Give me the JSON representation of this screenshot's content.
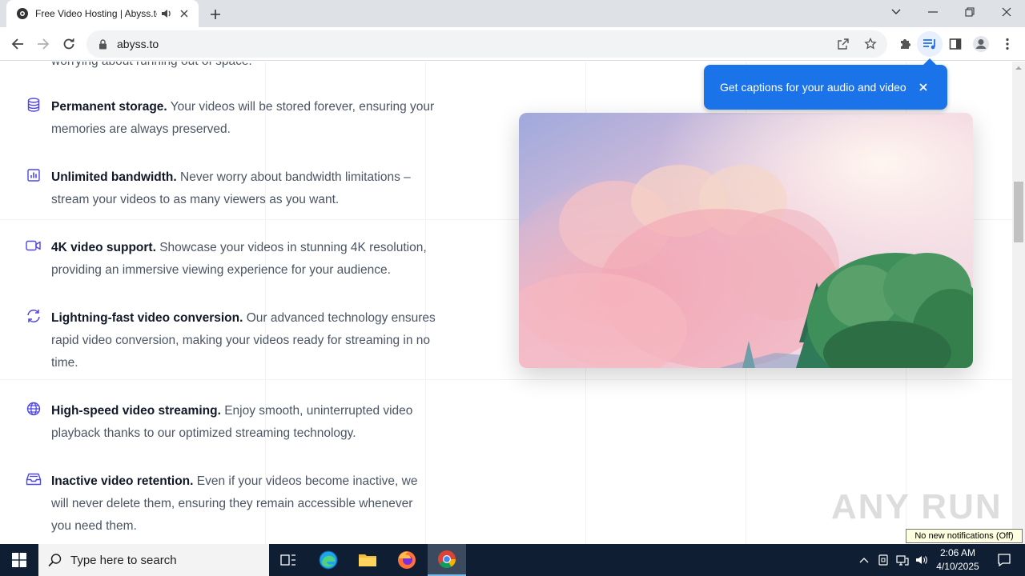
{
  "browser": {
    "tab_title": "Free Video Hosting | Abyss.to",
    "url": "abyss.to",
    "tab_favicon_icon": "abyss-favicon-icon",
    "caption_bubble_text": "Get captions for your audio and video"
  },
  "page": {
    "partial_text": "worrying about running out of space.",
    "features": [
      {
        "icon": "database-icon",
        "title": "Permanent storage.",
        "desc": " Your videos will be stored forever, ensuring your memories are always preserved."
      },
      {
        "icon": "bar-chart-icon",
        "title": "Unlimited bandwidth.",
        "desc": " Never worry about bandwidth limitations – stream your videos to as many viewers as you want."
      },
      {
        "icon": "video-camera-icon",
        "title": "4K video support.",
        "desc": " Showcase your videos in stunning 4K resolution, providing an immersive viewing experience for your audience."
      },
      {
        "icon": "refresh-icon",
        "title": "Lightning-fast video conversion.",
        "desc": " Our advanced technology ensures rapid video conversion, making your videos ready for streaming in no time."
      },
      {
        "icon": "globe-icon",
        "title": "High-speed video streaming.",
        "desc": " Enjoy smooth, uninterrupted video playback thanks to our optimized streaming technology."
      },
      {
        "icon": "inbox-archive-icon",
        "title": "Inactive video retention.",
        "desc": " Even if your videos become inactive, we will never delete them, ensuring they remain accessible whenever you need them."
      }
    ],
    "watermark": "ANY RUN"
  },
  "os": {
    "search_placeholder": "Type here to search",
    "time": "2:06 AM",
    "date": "4/10/2025",
    "notification_tooltip": "No new notifications (Off)"
  },
  "colors": {
    "accent_blue": "#1a73e8",
    "icon_indigo": "#4f46e5",
    "taskbar": "#0f1e33"
  }
}
